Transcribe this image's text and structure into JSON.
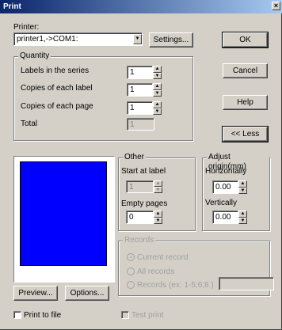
{
  "window": {
    "title": "Print",
    "close_glyph": "×"
  },
  "printer": {
    "label": "Printer:",
    "value": "printer1,->COM1:",
    "settings_label": "Settings..."
  },
  "buttons": {
    "ok": "OK",
    "cancel": "Cancel",
    "help": "Help",
    "less": "<< Less",
    "preview": "Preview...",
    "options": "Options..."
  },
  "quantity": {
    "title": "Quantity",
    "labels_in_series": {
      "label": "Labels in the series",
      "value": "1"
    },
    "copies_label": {
      "label": "Copies of each label",
      "value": "1"
    },
    "copies_page": {
      "label": "Copies of each page",
      "value": "1"
    },
    "total": {
      "label": "Total",
      "value": "1"
    }
  },
  "other": {
    "title": "Other",
    "start_label": {
      "label": "Start at label",
      "value": "1"
    },
    "empty_pages": {
      "label": "Empty pages",
      "value": "0"
    }
  },
  "origin": {
    "title": "Adjust origin(mm)",
    "horizontally": {
      "label": "Horizontally",
      "value": "0.00"
    },
    "vertically": {
      "label": "Vertically",
      "value": "0.00"
    }
  },
  "records": {
    "title": "Records",
    "current": "Current record",
    "all": "All records",
    "range": "Records (ex: 1-5;6;8 )"
  },
  "checks": {
    "print_to_file": "Print to file",
    "test_print": "Test print"
  },
  "arrows": {
    "up": "▲",
    "down": "▼"
  },
  "colors": {
    "preview": "#0000ff",
    "face": "#d4d0c8"
  }
}
